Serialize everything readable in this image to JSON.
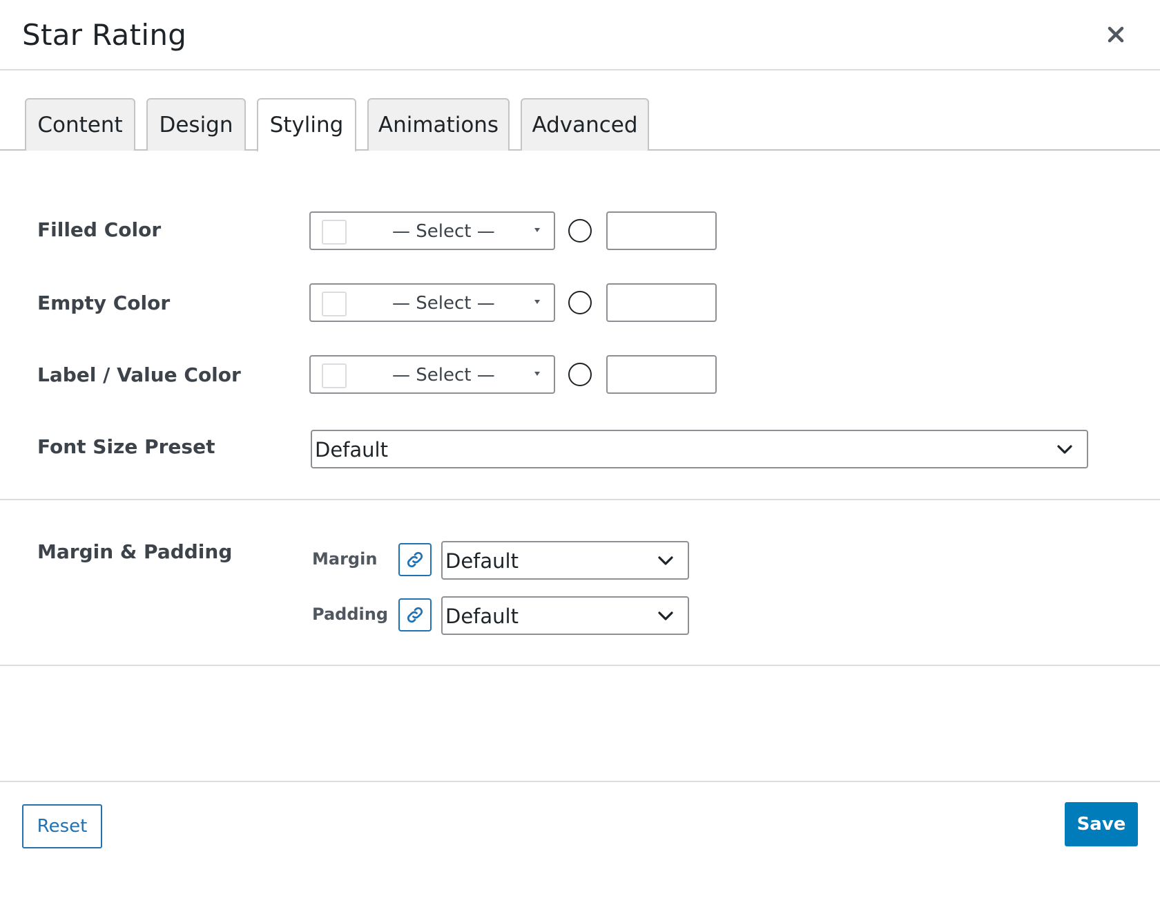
{
  "dialog": {
    "title": "Star Rating",
    "close_icon": "close-icon"
  },
  "tabs": [
    {
      "label": "Content",
      "active": false
    },
    {
      "label": "Design",
      "active": false
    },
    {
      "label": "Styling",
      "active": true
    },
    {
      "label": "Animations",
      "active": false
    },
    {
      "label": "Advanced",
      "active": false
    }
  ],
  "styling": {
    "filled_color": {
      "label": "Filled Color",
      "select_text": "— Select —",
      "value": ""
    },
    "empty_color": {
      "label": "Empty Color",
      "select_text": "— Select —",
      "value": ""
    },
    "label_value_color": {
      "label": "Label / Value Color",
      "select_text": "— Select —",
      "value": ""
    },
    "font_size_preset": {
      "label": "Font Size Preset",
      "value": "Default"
    }
  },
  "spacing": {
    "label": "Margin & Padding",
    "margin": {
      "label": "Margin",
      "value": "Default",
      "icon": "link-icon"
    },
    "padding": {
      "label": "Padding",
      "value": "Default",
      "icon": "link-icon"
    }
  },
  "footer": {
    "reset_label": "Reset",
    "save_label": "Save"
  },
  "colors": {
    "accent": "#2271b1",
    "save_bg": "#007cba",
    "tab_bg": "#f0f0f0",
    "border": "#8c8f94"
  }
}
